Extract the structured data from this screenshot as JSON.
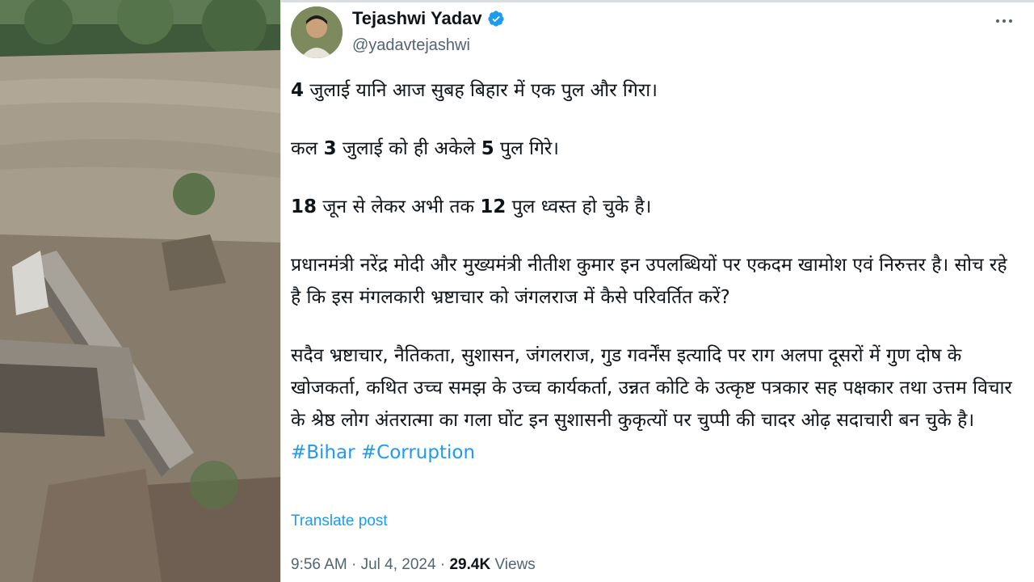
{
  "author": {
    "display_name": "Tejashwi Yadav",
    "handle": "@yadavtejashwi",
    "verified_icon": "verified-badge-icon"
  },
  "tweet": {
    "p1": {
      "a": "4",
      "b": " जुलाई यानि आज सुबह बिहार में एक पुल और गिरा।"
    },
    "p2": {
      "a": "कल ",
      "b": "3",
      "c": " जुलाई को ही अकेले ",
      "d": "5",
      "e": " पुल गिरे।"
    },
    "p3": {
      "a": "18",
      "b": " जून से लेकर अभी तक ",
      "c": "12",
      "d": " पुल ध्वस्त हो चुके है।"
    },
    "p4": "प्रधानमंत्री नरेंद्र मोदी और मुख्यमंत्री नीतीश कुमार इन उपलब्धियों पर एकदम खामोश एवं निरुत्तर है। सोच रहे है कि इस मंगलकारी भ्रष्टाचार को जंगलराज में कैसे परिवर्तित करें?",
    "p5": "सदैव भ्रष्टाचार, नैतिकता, सुशासन, जंगलराज, गुड गवर्नेंस इत्यादि पर राग अलपा दूसरों में गुण दोष के खोजकर्ता, कथित उच्च समझ के उच्च कार्यकर्ता, उन्नत कोटि के उत्कृष्ट पत्रकार सह पक्षकार तथा उत्तम विचार के श्रेष्ठ लोग अंतरात्मा का गला घोंट इन सुशासनी कुकृत्यों पर चुप्पी की चादर ओढ़ सदाचारी बन चुके है।",
    "hashtags": [
      "#Bihar",
      "#Corruption"
    ]
  },
  "translate_label": "Translate post",
  "meta": {
    "time": "9:56 AM",
    "separator": " · ",
    "date": "Jul 4, 2024",
    "views_count": "29.4K",
    "views_label": " Views"
  },
  "colors": {
    "link": "#1d9bf0",
    "text": "#0f1419",
    "secondary": "#536471"
  }
}
